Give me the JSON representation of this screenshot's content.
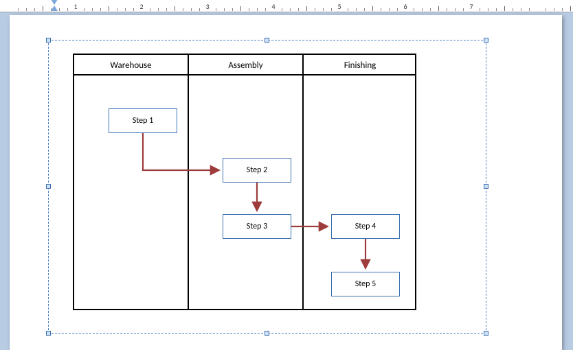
{
  "chart_data": {
    "type": "diagram",
    "swimlanes": [
      "Warehouse",
      "Assembly",
      "Finishing"
    ],
    "steps": [
      {
        "id": "s1",
        "label": "Step 1",
        "lane": "Warehouse"
      },
      {
        "id": "s2",
        "label": "Step 2",
        "lane": "Assembly"
      },
      {
        "id": "s3",
        "label": "Step 3",
        "lane": "Assembly"
      },
      {
        "id": "s4",
        "label": "Step 4",
        "lane": "Finishing"
      },
      {
        "id": "s5",
        "label": "Step 5",
        "lane": "Finishing"
      }
    ],
    "connectors": [
      {
        "from": "s1",
        "to": "s2"
      },
      {
        "from": "s2",
        "to": "s3"
      },
      {
        "from": "s3",
        "to": "s4"
      },
      {
        "from": "s4",
        "to": "s5"
      }
    ]
  },
  "ruler": {
    "numbers": [
      "1",
      "2",
      "3",
      "4",
      "5",
      "6",
      "7"
    ]
  },
  "lanes": {
    "l0": "Warehouse",
    "l1": "Assembly",
    "l2": "Finishing"
  },
  "steps": {
    "s1": "Step 1",
    "s2": "Step 2",
    "s3": "Step 3",
    "s4": "Step 4",
    "s5": "Step 5"
  },
  "colors": {
    "boxBorder": "#3a6fb0",
    "arrow": "#9e3b3b",
    "selection": "#4a7fc1"
  }
}
